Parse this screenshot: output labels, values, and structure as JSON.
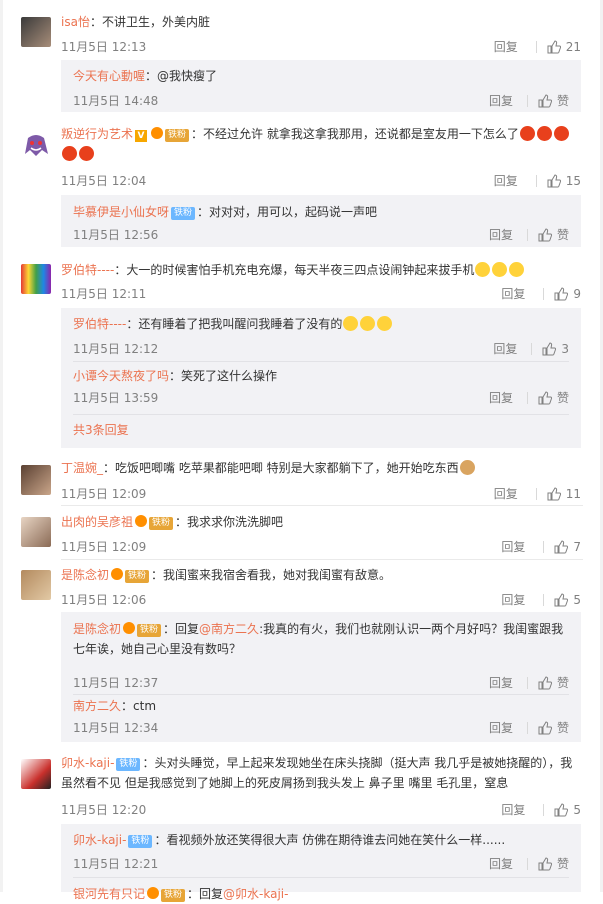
{
  "labels": {
    "reply": "回复",
    "like": "赞"
  },
  "comments": [
    {
      "user": "isa怡",
      "text": "：不讲卫生，外美内脏",
      "time": "11月5日 12:13",
      "likes": "21"
    },
    {
      "user": "叛逆行为艺术",
      "badge": "铁粉",
      "text": "：不经过允许 就拿我这拿我那用，还说都是室友用一下怎么了",
      "time": "11月5日 12:04",
      "likes": "15"
    },
    {
      "user": "罗伯特----",
      "text": "：大一的时候害怕手机充电充爆，每天半夜三四点设闹钟起来拔手机",
      "time": "11月5日 12:11",
      "likes": "9"
    },
    {
      "user": "丁温婉_",
      "text": "：吃饭吧唧嘴 吃苹果都能吧唧 特别是大家都躺下了，她开始吃东西",
      "time": "11月5日 12:09",
      "likes": "11"
    },
    {
      "user": "出肉的吴彦祖",
      "badge": "铁粉",
      "text": "：我求求你洗洗脚吧",
      "time": "11月5日 12:09",
      "likes": "7"
    },
    {
      "user": "是陈念初",
      "badge": "铁粉",
      "text": "：我闺蜜来我宿舍看我，她对我闺蜜有敌意。",
      "time": "11月5日 12:06",
      "likes": "5"
    },
    {
      "user": "卯水-kaji-",
      "badge": "铁粉",
      "text_line1": "：头对头睡觉，早上起来发现她坐在床头挠脚（挺大声 我几乎是被她挠醒的），我",
      "text_line2": "虽然看不见 但是我感觉到了她脚上的死皮屑扬到我头发上 鼻子里 嘴里 毛孔里，窒息",
      "time": "11月5日 12:20",
      "likes": "5"
    }
  ],
  "replies": [
    {
      "user": "今天有心動喔",
      "text": "：@我快瘦了",
      "time": "11月5日 14:48",
      "like_text": "赞"
    },
    {
      "user": "毕慕伊是小仙女呀",
      "badge": "铁粉",
      "text": "：对对对，用可以，起码说一声吧",
      "time": "11月5日 12:56",
      "like_text": "赞"
    },
    {
      "user": "罗伯特----",
      "text": "：还有睡着了把我叫醒问我睡着了没有的",
      "time": "11月5日 12:12",
      "like_text": "3"
    },
    {
      "user": "小谭今天熬夜了吗",
      "text": "：笑死了这什么操作",
      "time": "11月5日 13:59",
      "like_text": "赞"
    },
    {
      "user": "是陈念初",
      "badge": "铁粉",
      "prefix": "：回复",
      "mention": "@南方二久",
      "text_line1": ":我真的有火，我们也就刚认识一两个月好吗？我闺蜜跟我",
      "text_line2": "七年诶，她自己心里没有数吗？",
      "time": "11月5日 12:37",
      "like_text": "赞"
    },
    {
      "user": "南方二久",
      "text": "：ctm",
      "time": "11月5日 12:34",
      "like_text": "赞"
    },
    {
      "user": "卯水-kaji-",
      "badge": "铁粉",
      "text": "：看视频外放还笑得很大声 仿佛在期待谁去问她在笑什么一样......",
      "time": "11月5日 12:21",
      "like_text": "赞"
    },
    {
      "user": "银河先有只记",
      "badge": "铁粉",
      "prefix": "：回复",
      "mention": "@卯水-kaji-"
    }
  ],
  "more_replies": "共3条回复"
}
